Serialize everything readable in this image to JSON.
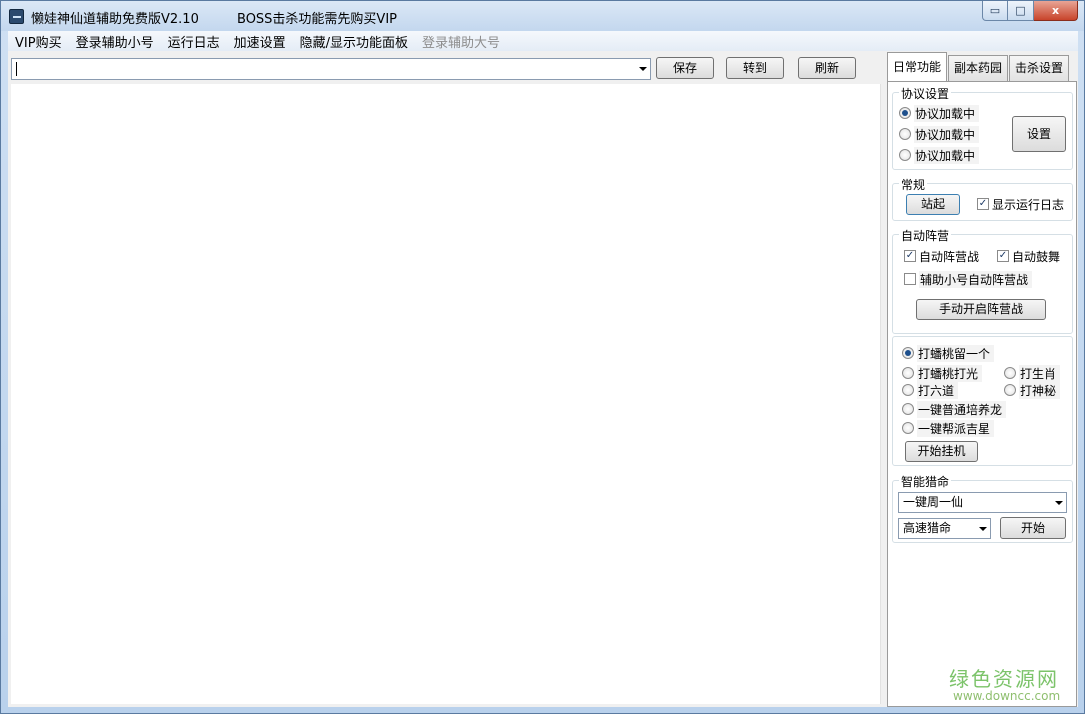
{
  "window": {
    "title": "懒娃神仙道辅助免费版V2.10",
    "notice": "BOSS击杀功能需先购买VIP",
    "minimize_glyph": "▭",
    "maximize_glyph": "□",
    "close_glyph": "x"
  },
  "menu": {
    "items": [
      "VIP购买",
      "登录辅助小号",
      "运行日志",
      "加速设置",
      "隐藏/显示功能面板",
      "登录辅助大号"
    ]
  },
  "toolbar": {
    "address_value": "",
    "save_label": "保存",
    "goto_label": "转到",
    "refresh_label": "刷新"
  },
  "tabs": [
    "日常功能",
    "副本药园",
    "击杀设置"
  ],
  "protocol": {
    "title": "协议设置",
    "options": [
      "协议加载中",
      "协议加载中",
      "协议加载中"
    ],
    "settings_label": "设置"
  },
  "general": {
    "title": "常规",
    "stand_label": "站起",
    "show_log_label": "显示运行日志",
    "show_log_mark": "✓"
  },
  "camp": {
    "title": "自动阵营",
    "auto_battle_label": "自动阵营战",
    "auto_battle_mark": "✓",
    "auto_cheer_label": "自动鼓舞",
    "auto_cheer_mark": "✓",
    "alt_auto_battle_label": "辅助小号自动阵营战",
    "manual_start_label": "手动开启阵营战"
  },
  "farming": {
    "opt1": "打蟠桃留一个",
    "opt2": "打蟠桃打光",
    "opt3": "打生肖",
    "opt4": "打六道",
    "opt5": "打神秘",
    "opt6": "一键普通培养龙",
    "opt7": "一键帮派吉星",
    "start_label": "开始挂机"
  },
  "hunt": {
    "title": "智能猎命",
    "mode_value": "一键周一仙",
    "speed_value": "高速猎命",
    "start_label": "开始"
  },
  "watermark": {
    "cn": "绿色资源网",
    "url": "www.downcc.com"
  }
}
